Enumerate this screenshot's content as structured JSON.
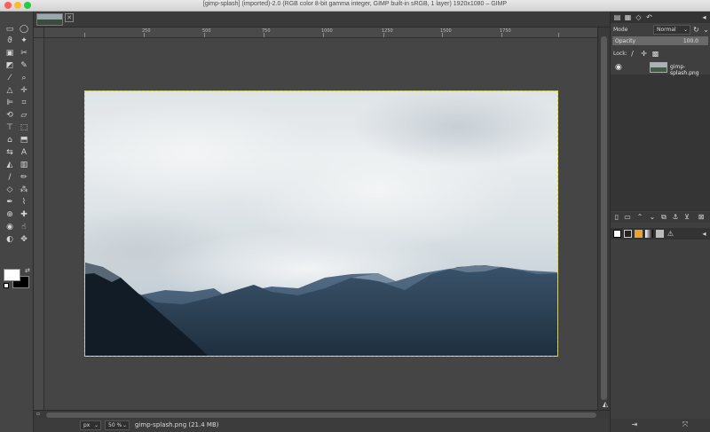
{
  "window": {
    "title": "[gimp-splash] (imported)-2.0 (RGB color 8-bit gamma integer, GIMP built-in sRGB, 1 layer) 1920x1080 – GIMP"
  },
  "ruler": {
    "labels": [
      "250",
      "500",
      "750",
      "1000",
      "1250",
      "1500",
      "1750"
    ]
  },
  "statusbar": {
    "unit": "px",
    "zoom": "50 %",
    "file_info": "gimp-splash.png (21.4 MB)"
  },
  "layers_panel": {
    "mode_label": "Mode",
    "mode_value": "Normal",
    "opacity_label": "Opacity",
    "opacity_value": "100.0",
    "opacity_fraction": 1.0,
    "lock_label": "Lock:",
    "layer": {
      "name": "gimp-splash.png",
      "visible": true
    }
  },
  "colors": {
    "foreground": "#ffffff",
    "background": "#000000"
  },
  "icons": {
    "canvas_nav": "navigate-arrow-icon",
    "zoom_nav": "navigate-icon"
  }
}
